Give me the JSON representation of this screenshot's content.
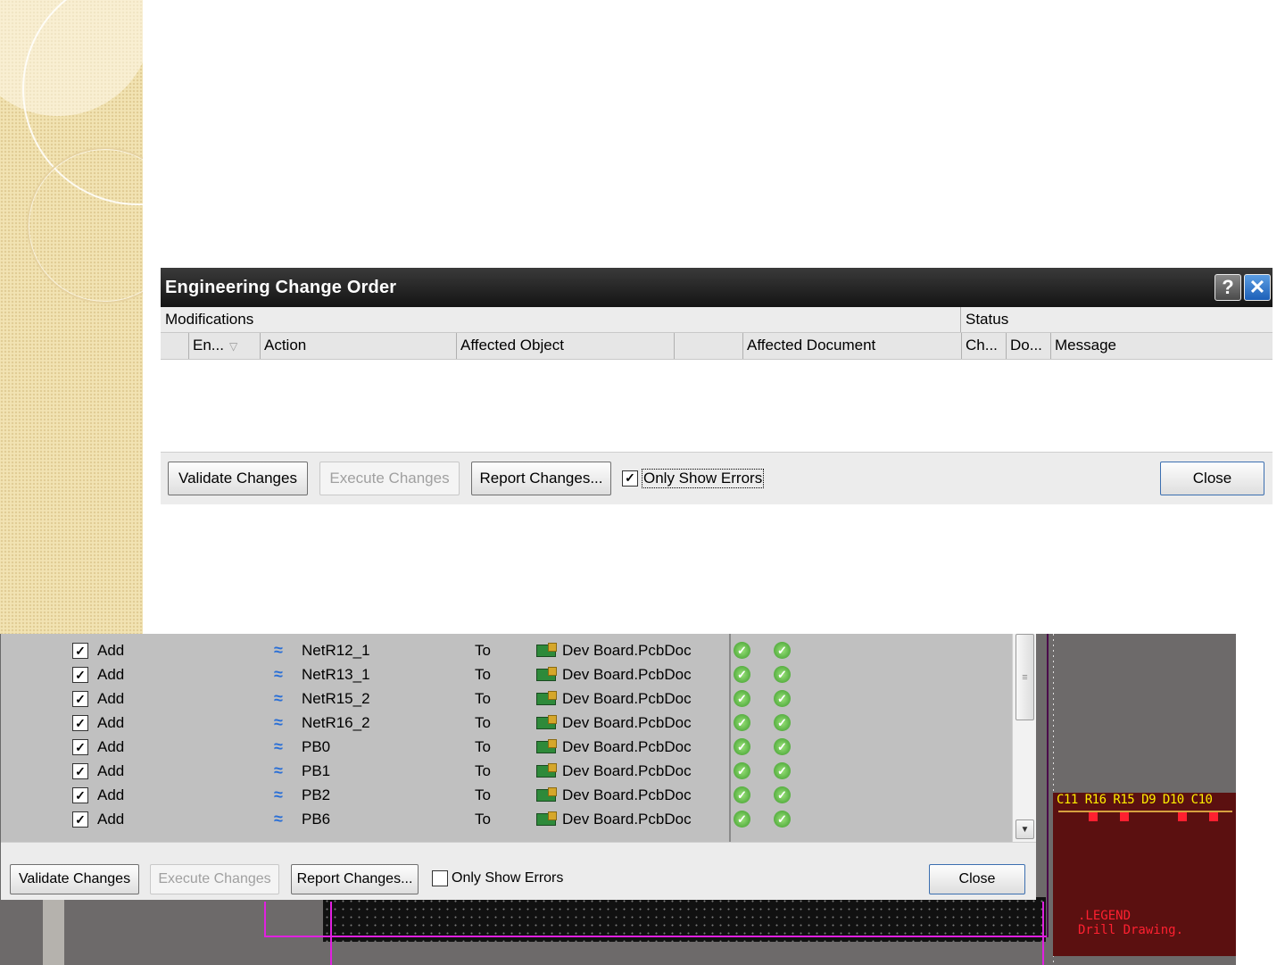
{
  "top_dialog": {
    "title": "Engineering Change Order",
    "help_button": "?",
    "close_icon": "✕",
    "group_headers": {
      "modifications": "Modifications",
      "status": "Status"
    },
    "columns": {
      "enable": "En...",
      "action": "Action",
      "affected_object": "Affected Object",
      "affected_document": "Affected Document",
      "check": "Ch...",
      "done": "Do...",
      "message": "Message"
    },
    "buttons": {
      "validate": "Validate Changes",
      "execute": "Execute Changes",
      "report": "Report Changes...",
      "only_errors": "Only Show Errors",
      "only_errors_checked": true,
      "close": "Close"
    }
  },
  "bottom_dialog": {
    "rows": [
      {
        "action": "Add",
        "object": "NetR12_1",
        "to": "To",
        "document": "Dev Board.PcbDoc"
      },
      {
        "action": "Add",
        "object": "NetR13_1",
        "to": "To",
        "document": "Dev Board.PcbDoc"
      },
      {
        "action": "Add",
        "object": "NetR15_2",
        "to": "To",
        "document": "Dev Board.PcbDoc"
      },
      {
        "action": "Add",
        "object": "NetR16_2",
        "to": "To",
        "document": "Dev Board.PcbDoc"
      },
      {
        "action": "Add",
        "object": "PB0",
        "to": "To",
        "document": "Dev Board.PcbDoc"
      },
      {
        "action": "Add",
        "object": "PB1",
        "to": "To",
        "document": "Dev Board.PcbDoc"
      },
      {
        "action": "Add",
        "object": "PB2",
        "to": "To",
        "document": "Dev Board.PcbDoc"
      },
      {
        "action": "Add",
        "object": "PB6",
        "to": "To",
        "document": "Dev Board.PcbDoc"
      }
    ],
    "buttons": {
      "validate": "Validate Changes",
      "execute": "Execute Changes",
      "report": "Report Changes...",
      "only_errors": "Only Show Errors",
      "only_errors_checked": false,
      "close": "Close"
    }
  },
  "pcb": {
    "designators": "C11 R16 R15 D9  D10 C10",
    "legend": ".LEGEND",
    "drill": "Drill Drawing."
  },
  "icons": {
    "net": "net-icon",
    "pcb_document": "pcb-document-icon",
    "check_ok": "check-ok-icon"
  },
  "colors": {
    "titlebar": "#141414",
    "close_button": "#1c5fb8",
    "net_icon": "#2a6fd6",
    "status_ok": "#3b9a2a",
    "pcb_board": "#5b1010",
    "pcb_designator": "#ffee00",
    "pcb_text": "#ff2030",
    "trace_magenta": "#e020e0"
  }
}
